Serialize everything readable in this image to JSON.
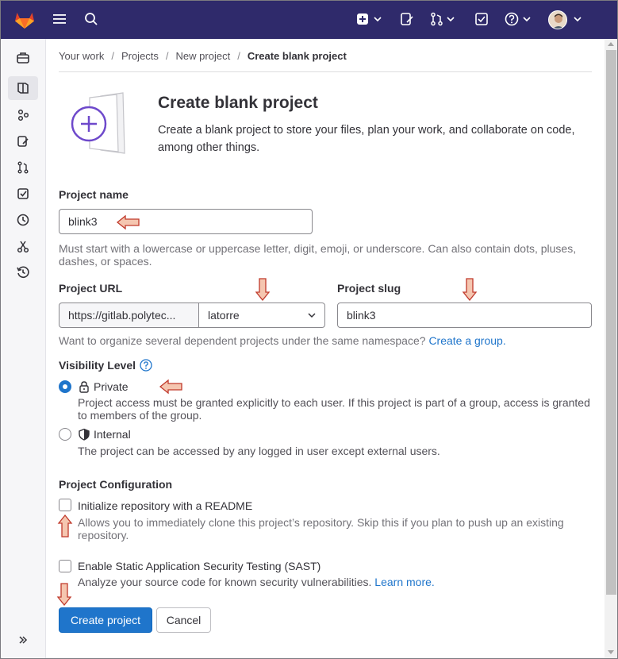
{
  "topbar": {
    "logo": "gitlab-logo",
    "menu_icon": "hamburger-icon",
    "search_icon": "search-icon",
    "new_icon": "plus-square-icon",
    "issues_icon": "issues-icon",
    "mr_icon": "merge-request-icon",
    "todo_icon": "todo-icon",
    "help_icon": "help-icon"
  },
  "sidebar": {
    "items": [
      "briefcase-icon",
      "project-icon",
      "group-icon",
      "issues-icon",
      "merge-request-icon",
      "todo-icon",
      "clock-icon",
      "snippet-icon",
      "history-icon"
    ],
    "expand_icon": "chevron-double-right-icon"
  },
  "breadcrumb": [
    "Your work",
    "Projects",
    "New project",
    "Create blank project"
  ],
  "hero": {
    "title": "Create blank project",
    "description": "Create a blank project to store your files, plan your work, and collaborate on code, among other things."
  },
  "form": {
    "project_name_label": "Project name",
    "project_name_value": "blink3",
    "project_name_help": "Must start with a lowercase or uppercase letter, digit, emoji, or underscore. Can also contain dots, pluses, dashes, or spaces.",
    "project_url_label": "Project URL",
    "project_url_prefix": "https://gitlab.polytec...",
    "namespace_value": "latorre",
    "project_slug_label": "Project slug",
    "project_slug_value": "blink3",
    "namespace_help": "Want to organize several dependent projects under the same namespace?",
    "namespace_help_link": "Create a group.",
    "visibility_label": "Visibility Level",
    "private_label": "Private",
    "private_desc": "Project access must be granted explicitly to each user. If this project is part of a group, access is granted to members of the group.",
    "internal_label": "Internal",
    "internal_desc": "The project can be accessed by any logged in user except external users.",
    "config_label": "Project Configuration",
    "readme_label": "Initialize repository with a README",
    "readme_desc": "Allows you to immediately clone this project’s repository. Skip this if you plan to push up an existing repository.",
    "sast_label": "Enable Static Application Security Testing (SAST)",
    "sast_desc": "Analyze your source code for known security vulnerabilities.",
    "sast_link": "Learn more.",
    "create_button": "Create project",
    "cancel_button": "Cancel"
  },
  "colors": {
    "topbar": "#2f2a6b",
    "primary": "#1f75cb",
    "arrow_fill": "#f5c6b0",
    "arrow_stroke": "#c0392b"
  }
}
